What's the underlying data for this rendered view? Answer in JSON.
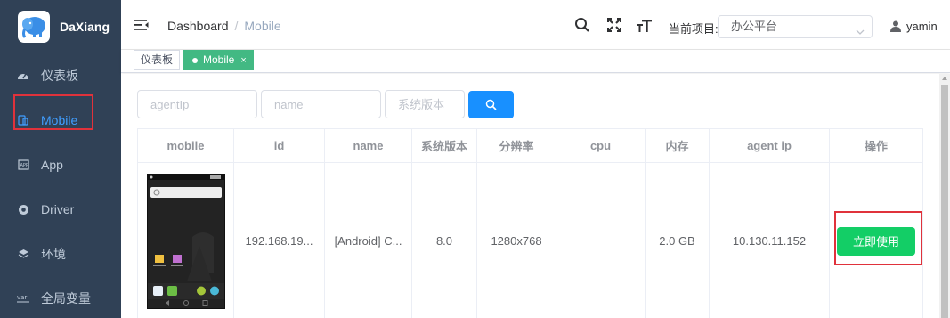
{
  "app": {
    "title": "DaXiang"
  },
  "sidebar": {
    "items": [
      {
        "label": "仪表板",
        "icon": "dashboard-icon"
      },
      {
        "label": "Mobile",
        "icon": "mobile-icon",
        "active": true
      },
      {
        "label": "App",
        "icon": "app-icon"
      },
      {
        "label": "Driver",
        "icon": "chrome-icon"
      },
      {
        "label": "环境",
        "icon": "layers-icon"
      },
      {
        "label": "全局变量",
        "icon": "var-icon"
      }
    ]
  },
  "header": {
    "breadcrumb": {
      "home": "Dashboard",
      "separator": "/",
      "current": "Mobile"
    },
    "project_label": "当前项目:",
    "project_value": "办公平台",
    "username": "yamin"
  },
  "tags": [
    {
      "label": "仪表板",
      "active": false
    },
    {
      "label": "Mobile",
      "active": true,
      "close": "×"
    }
  ],
  "filters": {
    "agent_ip_placeholder": "agentIp",
    "name_placeholder": "name",
    "version_placeholder": "系统版本"
  },
  "table": {
    "columns": [
      "mobile",
      "id",
      "name",
      "系统版本",
      "分辨率",
      "cpu",
      "内存",
      "agent ip",
      "操作"
    ],
    "rows": [
      {
        "id": "192.168.19...",
        "name": "[Android] C...",
        "version": "8.0",
        "resolution": "1280x768",
        "cpu": "",
        "memory": "2.0 GB",
        "agent_ip": "10.130.11.152",
        "action_label": "立即使用"
      }
    ]
  },
  "colors": {
    "sidebar_bg": "#304156",
    "active_menu": "#409eff",
    "tag_active": "#42b983",
    "primary_button": "#1890ff",
    "success_button": "#13ce66",
    "highlight_box": "#e0323b"
  }
}
